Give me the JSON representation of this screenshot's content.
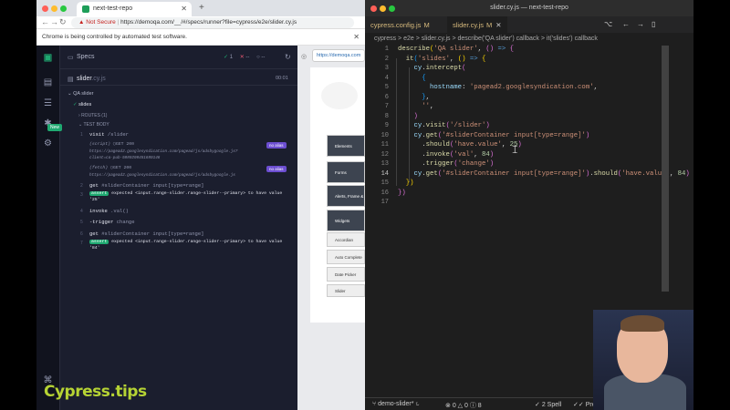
{
  "chrome": {
    "tab_title": "next-test-repo",
    "not_secure": "Not Secure",
    "url": "https://demoqa.com/__/#/specs/runner?file=cypress/e2e/slider.cy.js",
    "info_bar": "Chrome is being controlled by automated test software."
  },
  "cypress": {
    "specs_label": "Specs",
    "pass_count": "1",
    "fail_count": "--",
    "pending_count": "--",
    "spec_file": "slider",
    "spec_ext": ".cy.js",
    "spec_time": "00:01",
    "new_badge": "New",
    "logo_text": "Cypress.tips",
    "suite_title": "QA slider",
    "test_title": "slides",
    "routes_label": "ROUTES (1)",
    "test_body_label": "TEST BODY",
    "commands": [
      {
        "num": "1",
        "name": "visit",
        "arg": "/slider"
      },
      {
        "name": "(script)",
        "arg": "GET 200",
        "url": "https://pagead2.googlesyndication.com/pagead/js/adsbygoogle.js?",
        "url2": "client=ca-pub-5889298451689146",
        "alias": "no alias"
      },
      {
        "name": "(fetch)",
        "arg": "GET 200",
        "url": "https://pagead2.googlesyndication.com/pagead/js/adsbygoogle.js",
        "alias": "no alias"
      },
      {
        "num": "2",
        "name": "get",
        "arg": "#sliderContainer input[type=range]"
      },
      {
        "num": "3",
        "assert": "assert",
        "text": "expected <input.range-slider.range-slider--primary> to have value",
        "value": "'25'"
      },
      {
        "num": "4",
        "name": "invoke",
        "arg": ".val()"
      },
      {
        "num": "5",
        "name": "-trigger",
        "arg": "change"
      },
      {
        "num": "6",
        "name": "get",
        "arg": "#sliderContainer input[type=range]"
      },
      {
        "num": "7",
        "assert": "assert",
        "text": "expected <input.range-slider.range-slider--primary> to have value",
        "value": "'84'"
      }
    ],
    "preview_url": "https://demoqa.com",
    "menu": [
      "Elements",
      "Forms",
      "Alerts, Frame & Windows",
      "Widgets",
      "Accordian",
      "Auto Complete",
      "Date Picker",
      "Slider"
    ]
  },
  "vscode": {
    "window_title": "slider.cy.js — next-test-repo",
    "tabs": [
      {
        "name": "cypress.config.js",
        "status": "M"
      },
      {
        "name": "slider.cy.js",
        "status": "M"
      }
    ],
    "breadcrumbs": "cypress  >  e2e  >  slider.cy.js  >  describe('QA slider') callback  >  it('slides') callback",
    "line_numbers": [
      "1",
      "2",
      "3",
      "4",
      "5",
      "6",
      "7",
      "8",
      "9",
      "10",
      "11",
      "12",
      "13",
      "14",
      "15",
      "16",
      "17"
    ],
    "status_branch": "demo-slider*",
    "status_errors": "0",
    "status_warnings": "0",
    "status_info": "8",
    "status_spell": "2 Spell",
    "status_prettier": "Prettier"
  }
}
